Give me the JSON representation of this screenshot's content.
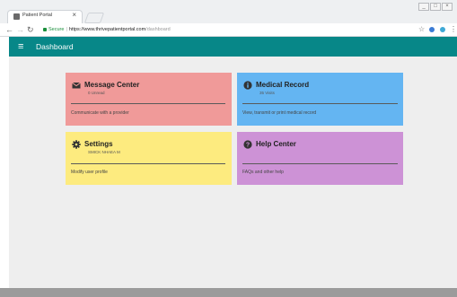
{
  "browser": {
    "tab_title": "Patient Portal",
    "tab_close": "×",
    "secure_label": "Secure",
    "url_prefix": "https://",
    "url_host": "www.thrivepatientportal.com",
    "url_path": "/dashboard"
  },
  "appbar": {
    "menu_glyph": "≡",
    "title": "Dashboard",
    "color": "#078788"
  },
  "cards": [
    {
      "title": "Message Center",
      "subtitle": "0 Unread",
      "description": "Communicate with a provider",
      "icon": "envelope-icon",
      "color": "#f09a99"
    },
    {
      "title": "Medical Record",
      "subtitle": "35 Visits",
      "description": "View, transmit or print medical record",
      "icon": "info-circle-icon",
      "color": "#64b5f2"
    },
    {
      "title": "Settings",
      "subtitle": "SMICK NHAEA M",
      "description": "Modify user profile",
      "icon": "gear-icon",
      "color": "#fdeb7f"
    },
    {
      "title": "Help Center",
      "subtitle": "",
      "description": "FAQs and other help",
      "icon": "help-circle-icon",
      "color": "#cd92d6"
    }
  ]
}
